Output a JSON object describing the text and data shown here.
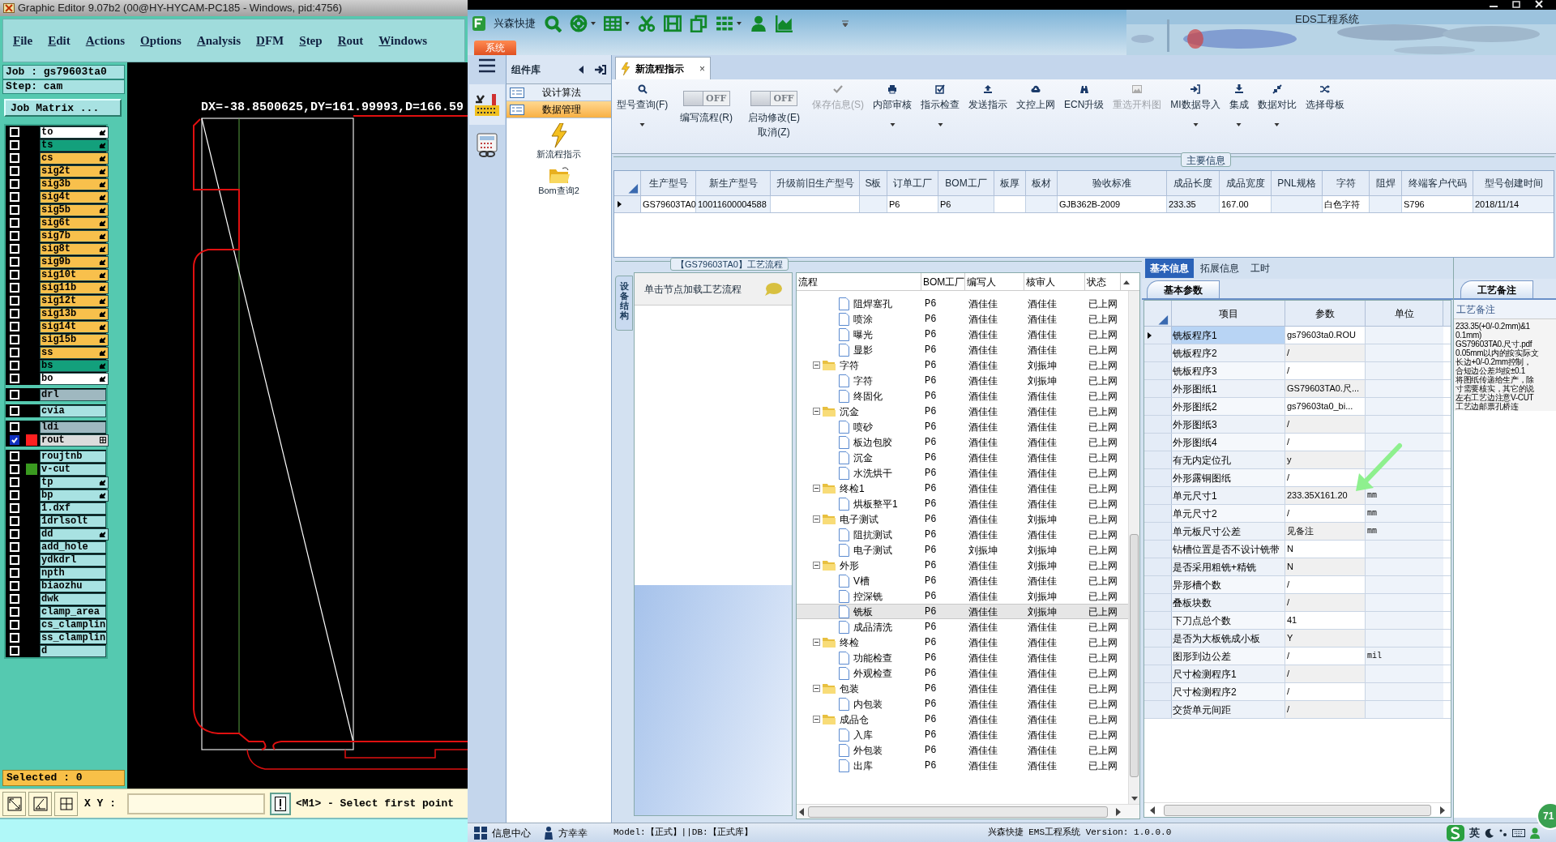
{
  "editor": {
    "title": "Graphic Editor 9.07b2 (00@HY-HYCAM-PC185 - Windows, pid:4756)",
    "menu": [
      "File",
      "Edit",
      "Actions",
      "Options",
      "Analysis",
      "DFM",
      "Step",
      "Rout",
      "Windows"
    ],
    "job": "Job : gs79603ta0",
    "step": "Step: cam",
    "matrix_button": "Job Matrix ...",
    "layer_groups": [
      [
        {
          "name": "to",
          "color": "#ffffff",
          "kind": "arrow",
          "selected": false
        },
        {
          "name": "ts",
          "color": "#13a07c",
          "kind": "arrow",
          "selected": false
        },
        {
          "name": "cs",
          "color": "#f8c04c",
          "kind": "arrow",
          "selected": false
        },
        {
          "name": "sig2t",
          "color": "#f8c04c",
          "kind": "arrow",
          "selected": false
        },
        {
          "name": "sig3b",
          "color": "#f8c04c",
          "kind": "arrow",
          "selected": false
        },
        {
          "name": "sig4t",
          "color": "#f8c04c",
          "kind": "arrow",
          "selected": false
        },
        {
          "name": "sig5b",
          "color": "#f8c04c",
          "kind": "arrow",
          "selected": false
        },
        {
          "name": "sig6t",
          "color": "#f8c04c",
          "kind": "arrow",
          "selected": false
        },
        {
          "name": "sig7b",
          "color": "#f8c04c",
          "kind": "arrow",
          "selected": false
        },
        {
          "name": "sig8t",
          "color": "#f8c04c",
          "kind": "arrow",
          "selected": false
        },
        {
          "name": "sig9b",
          "color": "#f8c04c",
          "kind": "arrow",
          "selected": false
        },
        {
          "name": "sig10t",
          "color": "#f8c04c",
          "kind": "arrow",
          "selected": false
        },
        {
          "name": "sig11b",
          "color": "#f8c04c",
          "kind": "arrow",
          "selected": false
        },
        {
          "name": "sig12t",
          "color": "#f8c04c",
          "kind": "arrow",
          "selected": false
        },
        {
          "name": "sig13b",
          "color": "#f8c04c",
          "kind": "arrow",
          "selected": false
        },
        {
          "name": "sig14t",
          "color": "#f8c04c",
          "kind": "arrow",
          "selected": false
        },
        {
          "name": "sig15b",
          "color": "#f8c04c",
          "kind": "arrow",
          "selected": false
        },
        {
          "name": "ss",
          "color": "#f8c04c",
          "kind": "arrow",
          "selected": false
        },
        {
          "name": "bs",
          "color": "#13a07c",
          "kind": "arrow",
          "selected": false
        },
        {
          "name": "bo",
          "color": "#ffffff",
          "kind": "arrow",
          "selected": false
        }
      ],
      [
        {
          "name": "drl",
          "color": "#9fb8c0",
          "selected": false
        }
      ],
      [
        {
          "name": "cvia",
          "color": "#a8e2e2",
          "selected": false
        }
      ],
      [
        {
          "name": "ldi",
          "color": "#9fb8c0",
          "selected": false
        },
        {
          "name": "rout",
          "color": "#dcdcdc",
          "swatch": {
            "color": "#ff2020"
          },
          "kind": "grid",
          "selected": true
        }
      ],
      [
        {
          "name": "roujtnb",
          "color": "#a8e2e2",
          "selected": false
        },
        {
          "name": "v-cut",
          "color": "#a8e2e2",
          "swatch": {
            "color": "#3a9a20"
          },
          "selected": false
        },
        {
          "name": "tp",
          "color": "#a8e2e2",
          "kind": "arrow",
          "selected": false
        },
        {
          "name": "bp",
          "color": "#a8e2e2",
          "kind": "arrow",
          "selected": false
        },
        {
          "name": "1.dxf",
          "color": "#a8e2e2",
          "selected": false
        },
        {
          "name": "1drlsolt",
          "color": "#a8e2e2",
          "selected": false
        },
        {
          "name": "dd",
          "color": "#a8e2e2",
          "kind": "arrow",
          "selected": false
        },
        {
          "name": "add_hole",
          "color": "#a8e2e2",
          "selected": false
        },
        {
          "name": "ydkdrl",
          "color": "#a8e2e2",
          "selected": false
        },
        {
          "name": "npth",
          "color": "#a8e2e2",
          "selected": false
        },
        {
          "name": "biaozhu",
          "color": "#a8e2e2",
          "selected": false
        },
        {
          "name": "dwk",
          "color": "#a8e2e2",
          "selected": false
        },
        {
          "name": "clamp_area",
          "color": "#a8e2e2",
          "selected": false
        },
        {
          "name": "cs_clamplin",
          "color": "#a8e2e2",
          "selected": false
        },
        {
          "name": "ss_clamplin",
          "color": "#a8e2e2",
          "selected": false
        },
        {
          "name": "d",
          "color": "#a8e2e2",
          "selected": false
        }
      ]
    ],
    "measure": "DX=-38.8500625,DY=161.99993,D=166.59",
    "selected_count": "Selected : 0",
    "xy_label": "X Y :",
    "prompt": "<M1> - Select first point"
  },
  "app": {
    "quick_title": "兴森快捷",
    "title": "EDS工程系统",
    "system_tab": "系统",
    "nav_title": "组件库",
    "nav_items": [
      {
        "label": "设计算法",
        "selected": false
      },
      {
        "label": "数据管理",
        "selected": true
      }
    ],
    "nav_tools": [
      "新流程指示",
      "Bom查询2"
    ],
    "doc_tab": "新流程指示",
    "doc_tab_close": "×",
    "ribbon": [
      {
        "kind": "button",
        "label": "型号查询(F)",
        "dropdown": true,
        "disabled": false
      },
      {
        "kind": "toggle",
        "label": "编写流程(R)",
        "switch": "OFF",
        "on": false
      },
      {
        "kind": "toggle",
        "label": "启动修改(E)",
        "sublabel": "取消(Z)",
        "switch": "OFF",
        "on": false
      },
      {
        "kind": "button",
        "label": "保存信息(S)",
        "dropdown": false,
        "disabled": true
      },
      {
        "kind": "button",
        "label": "内部审核",
        "dropdown": true,
        "disabled": false
      },
      {
        "kind": "button",
        "label": "指示检查",
        "dropdown": true,
        "disabled": false
      },
      {
        "kind": "button",
        "label": "发送指示",
        "dropdown": false,
        "disabled": false
      },
      {
        "kind": "button",
        "label": "文控上网",
        "dropdown": false,
        "disabled": false
      },
      {
        "kind": "button",
        "label": "ECN升级",
        "dropdown": false,
        "disabled": false
      },
      {
        "kind": "button",
        "label": "重选开料图",
        "dropdown": false,
        "disabled": true
      },
      {
        "kind": "button",
        "label": "MI数据导入",
        "dropdown": true,
        "disabled": false
      },
      {
        "kind": "button",
        "label": "集成",
        "dropdown": true,
        "disabled": false
      },
      {
        "kind": "button",
        "label": "数据对比",
        "dropdown": true,
        "disabled": false
      },
      {
        "kind": "button",
        "label": "选择母板",
        "dropdown": false,
        "disabled": false
      }
    ],
    "main_info": {
      "title": "主要信息",
      "columns": [
        "生产型号",
        "新生产型号",
        "升级前旧生产型号",
        "S板",
        "订单工厂",
        "BOM工厂",
        "板厚",
        "板材",
        "验收标准",
        "成品长度",
        "成品宽度",
        "PNL规格",
        "字符",
        "阻焊",
        "终端客户代码",
        "型号创建时间"
      ],
      "rows": [
        [
          "GS79603TA0",
          "10011600004588",
          null,
          null,
          "P6",
          "P6",
          null,
          null,
          "GJB362B-2009",
          "233.35",
          "167.00",
          null,
          "白色字符",
          null,
          "S796",
          "2018/11/14"
        ]
      ]
    },
    "flow": {
      "title": "【GS79603TA0】工艺流程",
      "side_tab": "设备结构",
      "hint": "单击节点加载工艺流程",
      "columns": [
        "流程",
        "BOM工厂",
        "编写人",
        "核审人",
        "状态"
      ],
      "tree": [
        {
          "kind": "scrolled",
          "children": [
            {
              "kind": "file",
              "name": "阻焊塞孔",
              "cells": [
                "P6",
                "酒佳佳",
                "酒佳佳",
                "已上网"
              ],
              "selected": false
            },
            {
              "kind": "file",
              "name": "喷涂",
              "cells": [
                "P6",
                "酒佳佳",
                "酒佳佳",
                "已上网"
              ],
              "selected": false
            },
            {
              "kind": "file",
              "name": "曝光",
              "cells": [
                "P6",
                "酒佳佳",
                "酒佳佳",
                "已上网"
              ],
              "selected": false
            },
            {
              "kind": "file",
              "name": "显影",
              "cells": [
                "P6",
                "酒佳佳",
                "酒佳佳",
                "已上网"
              ],
              "selected": false
            }
          ]
        },
        {
          "kind": "folder",
          "name": "字符",
          "cells": [
            "P6",
            "酒佳佳",
            "刘振坤",
            "已上网"
          ],
          "selected": false,
          "expanded": true,
          "children": [
            {
              "kind": "file",
              "name": "字符",
              "cells": [
                "P6",
                "酒佳佳",
                "刘振坤",
                "已上网"
              ],
              "selected": false
            },
            {
              "kind": "file",
              "name": "终固化",
              "cells": [
                "P6",
                "酒佳佳",
                "酒佳佳",
                "已上网"
              ],
              "selected": false
            }
          ]
        },
        {
          "kind": "folder",
          "name": "沉金",
          "cells": [
            "P6",
            "酒佳佳",
            "酒佳佳",
            "已上网"
          ],
          "selected": false,
          "expanded": true,
          "children": [
            {
              "kind": "file",
              "name": "喷砂",
              "cells": [
                "P6",
                "酒佳佳",
                "酒佳佳",
                "已上网"
              ],
              "selected": false
            },
            {
              "kind": "file",
              "name": "板边包胶",
              "cells": [
                "P6",
                "酒佳佳",
                "酒佳佳",
                "已上网"
              ],
              "selected": false
            },
            {
              "kind": "file",
              "name": "沉金",
              "cells": [
                "P6",
                "酒佳佳",
                "酒佳佳",
                "已上网"
              ],
              "selected": false
            },
            {
              "kind": "file",
              "name": "水洗烘干",
              "cells": [
                "P6",
                "酒佳佳",
                "酒佳佳",
                "已上网"
              ],
              "selected": false
            }
          ]
        },
        {
          "kind": "folder",
          "name": "终检1",
          "cells": [
            "P6",
            "酒佳佳",
            "酒佳佳",
            "已上网"
          ],
          "selected": false,
          "expanded": true,
          "children": [
            {
              "kind": "file",
              "name": "烘板整平1",
              "cells": [
                "P6",
                "酒佳佳",
                "酒佳佳",
                "已上网"
              ],
              "selected": false
            }
          ]
        },
        {
          "kind": "folder",
          "name": "电子测试",
          "cells": [
            "P6",
            "酒佳佳",
            "刘振坤",
            "已上网"
          ],
          "selected": false,
          "expanded": true,
          "children": [
            {
              "kind": "file",
              "name": "阻抗测试",
              "cells": [
                "P6",
                "酒佳佳",
                "酒佳佳",
                "已上网"
              ],
              "selected": false
            },
            {
              "kind": "file",
              "name": "电子测试",
              "cells": [
                "P6",
                "刘振坤",
                "刘振坤",
                "已上网"
              ],
              "selected": false
            }
          ]
        },
        {
          "kind": "folder",
          "name": "外形",
          "cells": [
            "P6",
            "酒佳佳",
            "刘振坤",
            "已上网"
          ],
          "selected": false,
          "expanded": true,
          "children": [
            {
              "kind": "file",
              "name": "V槽",
              "cells": [
                "P6",
                "酒佳佳",
                "酒佳佳",
                "已上网"
              ],
              "selected": false
            },
            {
              "kind": "file",
              "name": "控深铣",
              "cells": [
                "P6",
                "酒佳佳",
                "刘振坤",
                "已上网"
              ],
              "selected": false
            },
            {
              "kind": "file",
              "name": "铣板",
              "cells": [
                "P6",
                "酒佳佳",
                "刘振坤",
                "已上网"
              ],
              "selected": true
            },
            {
              "kind": "file",
              "name": "成品清洗",
              "cells": [
                "P6",
                "酒佳佳",
                "酒佳佳",
                "已上网"
              ],
              "selected": false
            }
          ]
        },
        {
          "kind": "folder",
          "name": "终检",
          "cells": [
            "P6",
            "酒佳佳",
            "酒佳佳",
            "已上网"
          ],
          "selected": false,
          "expanded": true,
          "children": [
            {
              "kind": "file",
              "name": "功能检查",
              "cells": [
                "P6",
                "酒佳佳",
                "酒佳佳",
                "已上网"
              ],
              "selected": false
            },
            {
              "kind": "file",
              "name": "外观检查",
              "cells": [
                "P6",
                "酒佳佳",
                "酒佳佳",
                "已上网"
              ],
              "selected": false
            }
          ]
        },
        {
          "kind": "folder",
          "name": "包装",
          "cells": [
            "P6",
            "酒佳佳",
            "酒佳佳",
            "已上网"
          ],
          "selected": false,
          "expanded": true,
          "children": [
            {
              "kind": "file",
              "name": "内包装",
              "cells": [
                "P6",
                "酒佳佳",
                "酒佳佳",
                "已上网"
              ],
              "selected": false
            }
          ]
        },
        {
          "kind": "folder",
          "name": "成品仓",
          "cells": [
            "P6",
            "酒佳佳",
            "酒佳佳",
            "已上网"
          ],
          "selected": false,
          "expanded": true,
          "children": [
            {
              "kind": "file",
              "name": "入库",
              "cells": [
                "P6",
                "酒佳佳",
                "酒佳佳",
                "已上网"
              ],
              "selected": false
            },
            {
              "kind": "file",
              "name": "外包装",
              "cells": [
                "P6",
                "酒佳佳",
                "酒佳佳",
                "已上网"
              ],
              "selected": false
            },
            {
              "kind": "file",
              "name": "出库",
              "cells": [
                "P6",
                "酒佳佳",
                "酒佳佳",
                "已上网"
              ],
              "selected": false
            }
          ]
        }
      ]
    },
    "params": {
      "tabs": [
        {
          "label": "基本信息",
          "selected": true
        },
        {
          "label": "拓展信息",
          "selected": false
        },
        {
          "label": "工时",
          "selected": false
        }
      ],
      "sub_tab": "基本参数",
      "columns": [
        "项目",
        "参数",
        "单位"
      ],
      "rows": [
        {
          "item": "铣板程序1",
          "value": "gs79603ta0.ROU",
          "selected": true
        },
        {
          "item": "铣板程序2",
          "value": "/",
          "selected": false
        },
        {
          "item": "铣板程序3",
          "value": "/",
          "selected": false
        },
        {
          "item": "外形图纸1",
          "value": "GS79603TA0.尺...",
          "selected": false
        },
        {
          "item": "外形图纸2",
          "value": "gs79603ta0_bi...",
          "selected": false
        },
        {
          "item": "外形图纸3",
          "value": "/",
          "selected": false
        },
        {
          "item": "外形图纸4",
          "value": "/",
          "selected": false
        },
        {
          "item": "有无内定位孔",
          "value": "y",
          "selected": false
        },
        {
          "item": "外形露铜图纸",
          "value": "/",
          "selected": false
        },
        {
          "item": "单元尺寸1",
          "value": "233.35X161.20",
          "unit": "mm",
          "selected": false
        },
        {
          "item": "单元尺寸2",
          "value": "/",
          "unit": "mm",
          "selected": false
        },
        {
          "item": "单元板尺寸公差",
          "value": "见备注",
          "unit": "mm",
          "selected": false
        },
        {
          "item": "钻槽位置是否不设计铣带",
          "value": "N",
          "selected": false
        },
        {
          "item": "是否采用粗铣+精铣",
          "value": "N",
          "selected": false
        },
        {
          "item": "异形槽个数",
          "value": "/",
          "selected": false
        },
        {
          "item": "叠板块数",
          "value": "/",
          "selected": false
        },
        {
          "item": "下刀点总个数",
          "value": "41",
          "selected": false
        },
        {
          "item": "是否为大板铣成小板",
          "value": "Y",
          "selected": false
        },
        {
          "item": "图形到边公差",
          "value": "/",
          "unit": "mil",
          "selected": false
        },
        {
          "item": "尺寸检测程序1",
          "value": "/",
          "selected": false
        },
        {
          "item": "尺寸检测程序2",
          "value": "/",
          "selected": false
        },
        {
          "item": "交货单元间距",
          "value": "/",
          "selected": false
        }
      ]
    },
    "notes": {
      "tab": "工艺备注",
      "label": "工艺备注",
      "lines": [
        "233.35(+0/-0.2mm)&1",
        "0.1mm)",
        "GS79603TA0.尺寸.pdf",
        "0.05mm以内的按实际文",
        "长边+0/-0.2mm控制，",
        "合短边公差均按±0.1",
        "将图纸传递给生产，除",
        "寸需要核实，其它的说",
        "左右工艺边注意V-CUT",
        "工艺边邮票孔桥连"
      ]
    },
    "status": {
      "items": [
        "信息中心",
        "方幸幸"
      ],
      "model": "Model:【正式】||DB:【正式库】",
      "version": "兴森快捷 EMS工程系统 Version: 1.0.0.0",
      "ime": "英",
      "badge": "71"
    }
  }
}
